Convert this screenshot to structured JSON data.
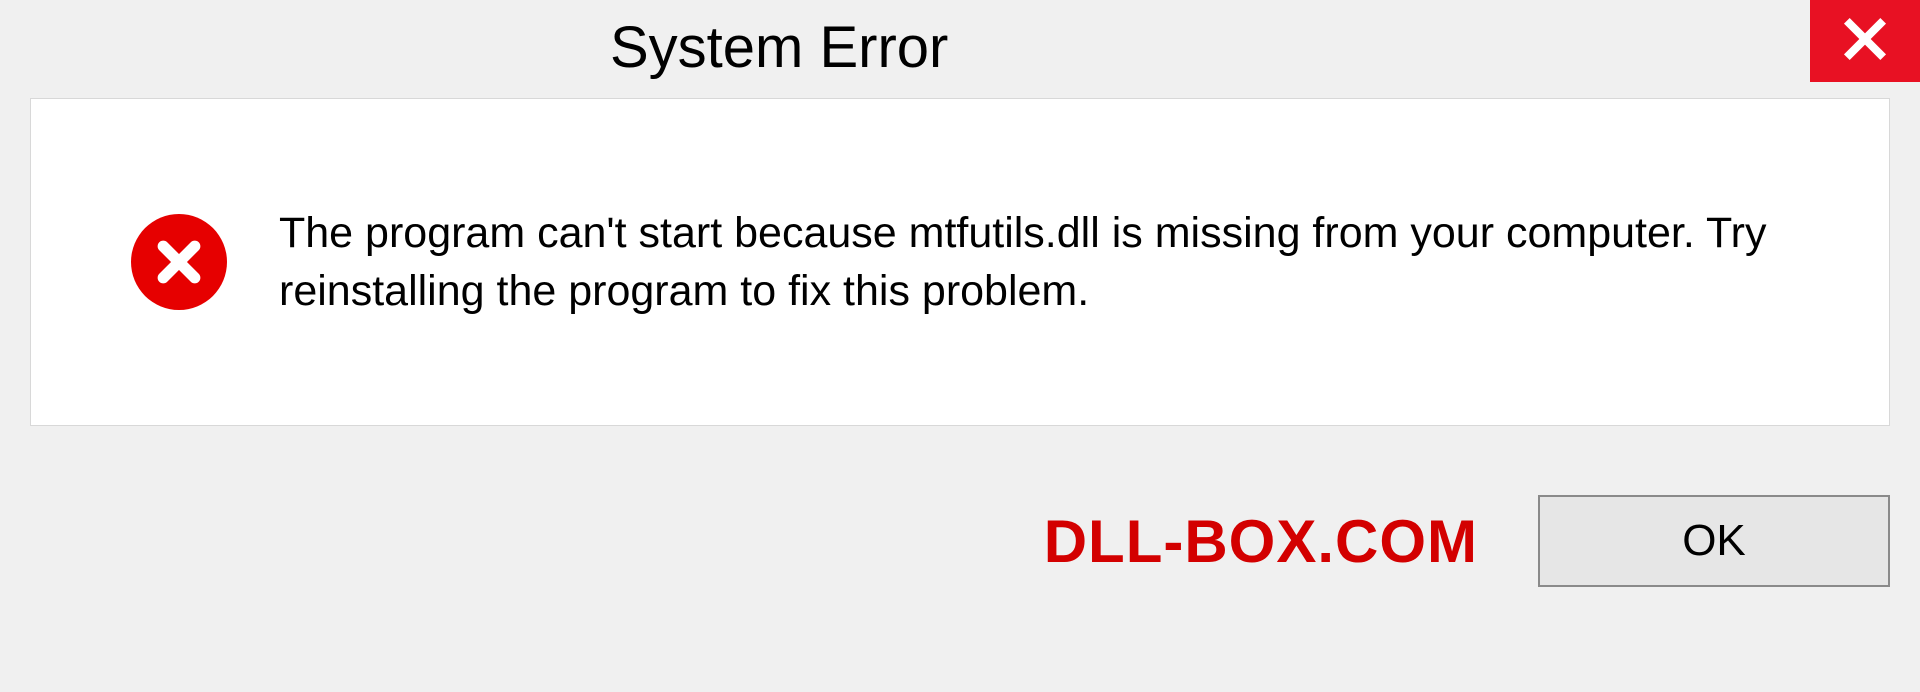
{
  "dialog": {
    "title": "System Error",
    "message": "The program can't start because mtfutils.dll is missing from your computer. Try reinstalling the program to fix this problem.",
    "ok_label": "OK"
  },
  "watermark": "DLL-BOX.COM",
  "colors": {
    "close_bg": "#e81123",
    "error_icon": "#e60000",
    "watermark": "#d30000"
  }
}
